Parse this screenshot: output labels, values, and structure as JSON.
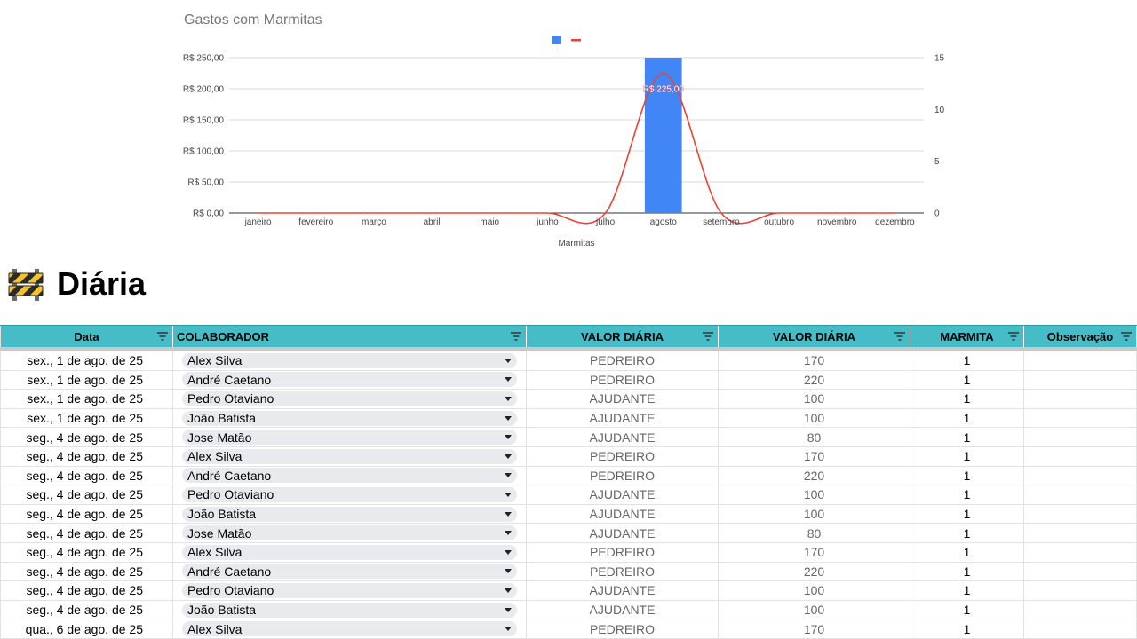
{
  "chart_data": {
    "type": "bar",
    "title": "Gastos com Marmitas",
    "xlabel": "Marmitas",
    "categories": [
      "janeiro",
      "fevereiro",
      "março",
      "abril",
      "maio",
      "junho",
      "julho",
      "agosto",
      "setembro",
      "outubro",
      "novembro",
      "dezembro"
    ],
    "series": [
      {
        "type": "bar",
        "axis": "left",
        "color": "#4285f4",
        "values": [
          0,
          0,
          0,
          0,
          0,
          0,
          0,
          250,
          0,
          0,
          0,
          0
        ]
      },
      {
        "type": "line",
        "axis": "right",
        "curve": "smooth",
        "color": "#ea4335",
        "values": [
          0,
          0,
          0,
          0,
          0,
          0,
          0,
          13.5,
          0,
          0,
          0,
          0
        ]
      }
    ],
    "data_labels": [
      {
        "category": "agosto",
        "text": "R$ 225,00"
      }
    ],
    "y_left": {
      "ticks": [
        "R$ 250,00",
        "R$ 200,00",
        "R$ 150,00",
        "R$ 100,00",
        "R$ 50,00",
        "R$ 0,00"
      ],
      "values": [
        250,
        200,
        150,
        100,
        50,
        0
      ],
      "range": [
        0,
        250
      ]
    },
    "y_right": {
      "ticks": [
        "15",
        "10",
        "5",
        "0"
      ],
      "values": [
        15,
        10,
        5,
        0
      ],
      "range": [
        0,
        15
      ]
    },
    "legend": "top",
    "grid": true
  },
  "section": {
    "icon": "construction-barrier-icon",
    "title": "Diária"
  },
  "table": {
    "header_color": "#46bdc6",
    "columns": [
      "Data",
      "COLABORADOR",
      "VALOR DIÁRIA",
      "VALOR DIÁRIA",
      "MARMITA",
      "Observação"
    ],
    "rows": [
      {
        "date": "sex., 1 de ago. de 25",
        "colaborador": "Alex Silva",
        "funcao": "PEDREIRO",
        "valor": "170",
        "marmita": "1",
        "obs": ""
      },
      {
        "date": "sex., 1 de ago. de 25",
        "colaborador": "André Caetano",
        "funcao": "PEDREIRO",
        "valor": "220",
        "marmita": "1",
        "obs": ""
      },
      {
        "date": "sex., 1 de ago. de 25",
        "colaborador": "Pedro Otaviano",
        "funcao": "AJUDANTE",
        "valor": "100",
        "marmita": "1",
        "obs": ""
      },
      {
        "date": "sex., 1 de ago. de 25",
        "colaborador": "João Batista",
        "funcao": "AJUDANTE",
        "valor": "100",
        "marmita": "1",
        "obs": ""
      },
      {
        "date": "seg., 4 de ago. de 25",
        "colaborador": "Jose Matão",
        "funcao": "AJUDANTE",
        "valor": "80",
        "marmita": "1",
        "obs": ""
      },
      {
        "date": "seg., 4 de ago. de 25",
        "colaborador": "Alex Silva",
        "funcao": "PEDREIRO",
        "valor": "170",
        "marmita": "1",
        "obs": ""
      },
      {
        "date": "seg., 4 de ago. de 25",
        "colaborador": "André Caetano",
        "funcao": "PEDREIRO",
        "valor": "220",
        "marmita": "1",
        "obs": ""
      },
      {
        "date": "seg., 4 de ago. de 25",
        "colaborador": "Pedro Otaviano",
        "funcao": "AJUDANTE",
        "valor": "100",
        "marmita": "1",
        "obs": ""
      },
      {
        "date": "seg., 4 de ago. de 25",
        "colaborador": "João Batista",
        "funcao": "AJUDANTE",
        "valor": "100",
        "marmita": "1",
        "obs": ""
      },
      {
        "date": "seg., 4 de ago. de 25",
        "colaborador": "Jose Matão",
        "funcao": "AJUDANTE",
        "valor": "80",
        "marmita": "1",
        "obs": ""
      },
      {
        "date": "seg., 4 de ago. de 25",
        "colaborador": "Alex Silva",
        "funcao": "PEDREIRO",
        "valor": "170",
        "marmita": "1",
        "obs": ""
      },
      {
        "date": "seg., 4 de ago. de 25",
        "colaborador": "André Caetano",
        "funcao": "PEDREIRO",
        "valor": "220",
        "marmita": "1",
        "obs": ""
      },
      {
        "date": "seg., 4 de ago. de 25",
        "colaborador": "Pedro Otaviano",
        "funcao": "AJUDANTE",
        "valor": "100",
        "marmita": "1",
        "obs": ""
      },
      {
        "date": "seg., 4 de ago. de 25",
        "colaborador": "João Batista",
        "funcao": "AJUDANTE",
        "valor": "100",
        "marmita": "1",
        "obs": ""
      },
      {
        "date": "qua., 6 de ago. de 25",
        "colaborador": "Alex Silva",
        "funcao": "PEDREIRO",
        "valor": "170",
        "marmita": "1",
        "obs": ""
      }
    ]
  }
}
